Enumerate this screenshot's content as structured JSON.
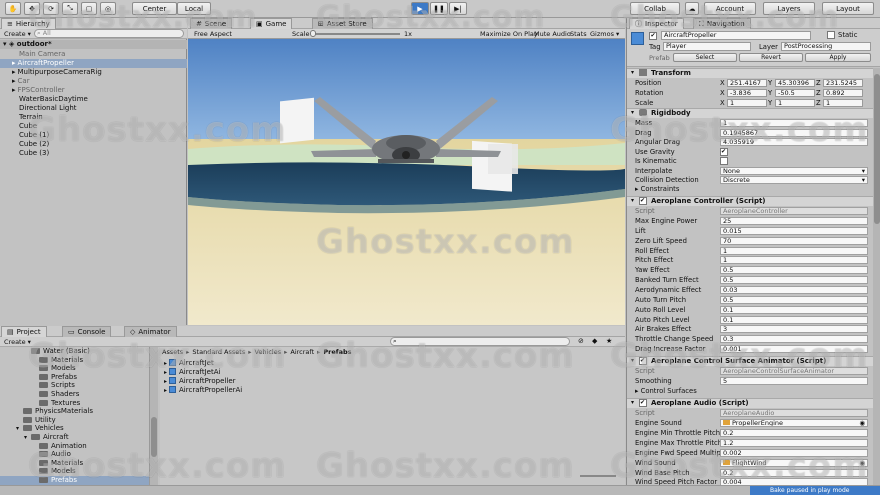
{
  "toolbar": {
    "pivot": "Center",
    "space": "Local",
    "collab": "Collab",
    "account": "Account",
    "layers": "Layers",
    "layout": "Layout"
  },
  "hierarchy": {
    "tab": "Hierarchy",
    "create": "Create",
    "search_placeholder": "All",
    "scene": "outdoor*",
    "items": [
      {
        "label": "Main Camera",
        "indent": 1,
        "arrow": false,
        "dim": true
      },
      {
        "label": "AircraftPropeller",
        "indent": 1,
        "arrow": true,
        "selected": true
      },
      {
        "label": "MultipurposeCameraRig",
        "indent": 1,
        "arrow": true
      },
      {
        "label": "Car",
        "indent": 1,
        "arrow": true,
        "dim": true
      },
      {
        "label": "FPSController",
        "indent": 1,
        "arrow": true,
        "dim": true
      },
      {
        "label": "WaterBasicDaytime",
        "indent": 1,
        "arrow": false
      },
      {
        "label": "Directional Light",
        "indent": 1,
        "arrow": false
      },
      {
        "label": "Terrain",
        "indent": 1,
        "arrow": false
      },
      {
        "label": "Cube",
        "indent": 1,
        "arrow": false
      },
      {
        "label": "Cube (1)",
        "indent": 1,
        "arrow": false
      },
      {
        "label": "Cube (2)",
        "indent": 1,
        "arrow": false
      },
      {
        "label": "Cube (3)",
        "indent": 1,
        "arrow": false
      }
    ]
  },
  "view_tabs": {
    "scene": "Scene",
    "game": "Game",
    "asset_store": "Asset Store"
  },
  "game_bar": {
    "aspect": "Free Aspect",
    "scale_label": "Scale",
    "scale_value": "1x",
    "maximize": "Maximize On Play",
    "mute": "Mute Audio",
    "stats": "Stats",
    "gizmos": "Gizmos"
  },
  "project": {
    "tabs": {
      "project": "Project",
      "console": "Console",
      "animator": "Animator"
    },
    "create": "Create",
    "tree": [
      {
        "label": "Water (Basic)",
        "indent": 3
      },
      {
        "label": "Materials",
        "indent": 4
      },
      {
        "label": "Models",
        "indent": 4
      },
      {
        "label": "Prefabs",
        "indent": 4
      },
      {
        "label": "Scripts",
        "indent": 4
      },
      {
        "label": "Shaders",
        "indent": 4
      },
      {
        "label": "Textures",
        "indent": 4
      },
      {
        "label": "PhysicsMaterials",
        "indent": 2
      },
      {
        "label": "Utility",
        "indent": 2
      },
      {
        "label": "Vehicles",
        "indent": 2
      },
      {
        "label": "Aircraft",
        "indent": 3
      },
      {
        "label": "Animation",
        "indent": 4
      },
      {
        "label": "Audio",
        "indent": 4
      },
      {
        "label": "Materials",
        "indent": 4
      },
      {
        "label": "Models",
        "indent": 4
      },
      {
        "label": "Prefabs",
        "indent": 4,
        "selected": true
      }
    ],
    "breadcrumb": [
      "Assets",
      "Standard Assets",
      "Vehicles",
      "Aircraft",
      "Prefabs"
    ],
    "files": [
      "AircraftJet",
      "AircraftJetAi",
      "AircraftPropeller",
      "AircraftPropellerAi"
    ]
  },
  "inspector": {
    "tabs": {
      "inspector": "Inspector",
      "navigation": "Navigation"
    },
    "object_name": "AircraftPropeller",
    "static": "Static",
    "tag_label": "Tag",
    "tag": "Player",
    "layer_label": "Layer",
    "layer": "PostProcessing",
    "prefab_label": "Prefab",
    "prefab_select": "Select",
    "prefab_revert": "Revert",
    "prefab_apply": "Apply",
    "transform": {
      "title": "Transform",
      "rows": [
        {
          "label": "Position",
          "x": "251.4167",
          "y": "45.30396",
          "z": "231.5245"
        },
        {
          "label": "Rotation",
          "x": "-3.836",
          "y": "-50.5",
          "z": "0.892"
        },
        {
          "label": "Scale",
          "x": "1",
          "y": "1",
          "z": "1"
        }
      ]
    },
    "rigidbody": {
      "title": "Rigidbody",
      "props": [
        {
          "label": "Mass",
          "value": "1"
        },
        {
          "label": "Drag",
          "value": "0.1945867"
        },
        {
          "label": "Angular Drag",
          "value": "4.035919"
        },
        {
          "label": "Use Gravity",
          "value": "✔",
          "check": true
        },
        {
          "label": "Is Kinematic",
          "value": "",
          "check": true
        },
        {
          "label": "Interpolate",
          "value": "None",
          "dropdown": true
        },
        {
          "label": "Collision Detection",
          "value": "Discrete",
          "dropdown": true
        }
      ],
      "constraints": "Constraints"
    },
    "controller": {
      "title": "Aeroplane Controller (Script)",
      "script_label": "Script",
      "script": "AeroplaneController",
      "props": [
        {
          "label": "Max Engine Power",
          "value": "25"
        },
        {
          "label": "Lift",
          "value": "0.015"
        },
        {
          "label": "Zero Lift Speed",
          "value": "70"
        },
        {
          "label": "Roll Effect",
          "value": "1"
        },
        {
          "label": "Pitch Effect",
          "value": "1"
        },
        {
          "label": "Yaw Effect",
          "value": "0.5"
        },
        {
          "label": "Banked Turn Effect",
          "value": "0.5"
        },
        {
          "label": "Aerodynamic Effect",
          "value": "0.03"
        },
        {
          "label": "Auto Turn Pitch",
          "value": "0.5"
        },
        {
          "label": "Auto Roll Level",
          "value": "0.1"
        },
        {
          "label": "Auto Pitch Level",
          "value": "0.1"
        },
        {
          "label": "Air Brakes Effect",
          "value": "3"
        },
        {
          "label": "Throttle Change Speed",
          "value": "0.3"
        },
        {
          "label": "Drag Increase Factor",
          "value": "0.001"
        }
      ]
    },
    "animator": {
      "title": "Aeroplane Control Surface Animator (Script)",
      "script_label": "Script",
      "script": "AeroplaneControlSurfaceAnimator",
      "smoothing_label": "Smoothing",
      "smoothing": "5",
      "surfaces": "Control Surfaces"
    },
    "audio": {
      "title": "Aeroplane Audio (Script)",
      "script_label": "Script",
      "script": "AeroplaneAudio",
      "props": [
        {
          "label": "Engine Sound",
          "value": "PropellerEngine",
          "asset": true
        },
        {
          "label": "Engine Min Throttle Pitch",
          "value": "0.2"
        },
        {
          "label": "Engine Max Throttle Pitch",
          "value": "1.2"
        },
        {
          "label": "Engine Fwd Speed Multiplier",
          "value": "0.002"
        },
        {
          "label": "Wind Sound",
          "value": "FlightWind",
          "asset": true
        },
        {
          "label": "Wind Base Pitch",
          "value": "0.2"
        },
        {
          "label": "Wind Speed Pitch Factor",
          "value": "0.004"
        }
      ]
    }
  },
  "status": "Bake paused in play mode",
  "watermark": "Ghostxx.com",
  "colors": {
    "accent": "#3d7ac7",
    "sky": "#5d8ec9",
    "sand": "#e8dcb2",
    "water": "#234a66"
  }
}
